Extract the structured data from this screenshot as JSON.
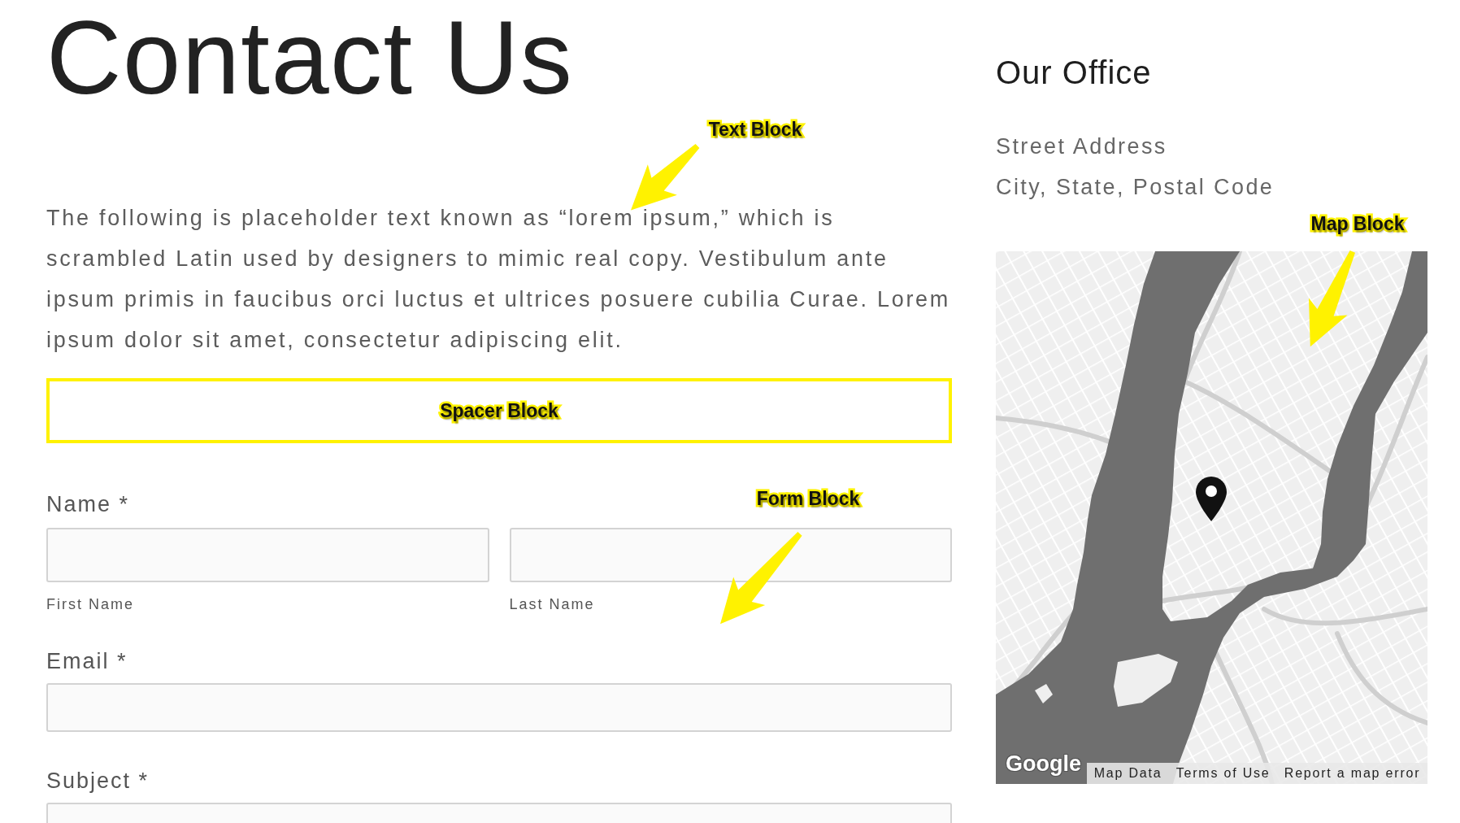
{
  "heading": "Contact Us",
  "text_block": {
    "annotation": {
      "kind": "arrow",
      "label": "Text Block"
    },
    "paragraph": "The following is placeholder text known as “lorem ipsum,” which is scrambled Latin used by designers to mimic real copy. Vestibulum ante ipsum primis in faucibus orci luctus et ultrices posuere cubilia Curae. Lorem ipsum dolor sit amet, consectetur adipiscing elit."
  },
  "spacer_block": {
    "annotation": {
      "kind": "frame",
      "label": "Spacer Block"
    }
  },
  "form_block": {
    "annotation": {
      "kind": "arrow",
      "label": "Form Block"
    },
    "fields": [
      {
        "kind": "name",
        "label": "Name *",
        "parts": [
          {
            "sublabel": "First Name"
          },
          {
            "sublabel": "Last Name"
          }
        ]
      },
      {
        "kind": "text",
        "label": "Email *"
      },
      {
        "kind": "text",
        "label": "Subject *"
      }
    ]
  },
  "office": {
    "title": "Our Office",
    "address_lines": [
      "Street Address",
      "City, State, Postal Code"
    ],
    "map_block": {
      "annotation": {
        "kind": "arrow",
        "label": "Map Block"
      },
      "logo": "Google",
      "links": [
        "Map Data",
        "Terms of Use",
        "Report a map error"
      ]
    }
  }
}
